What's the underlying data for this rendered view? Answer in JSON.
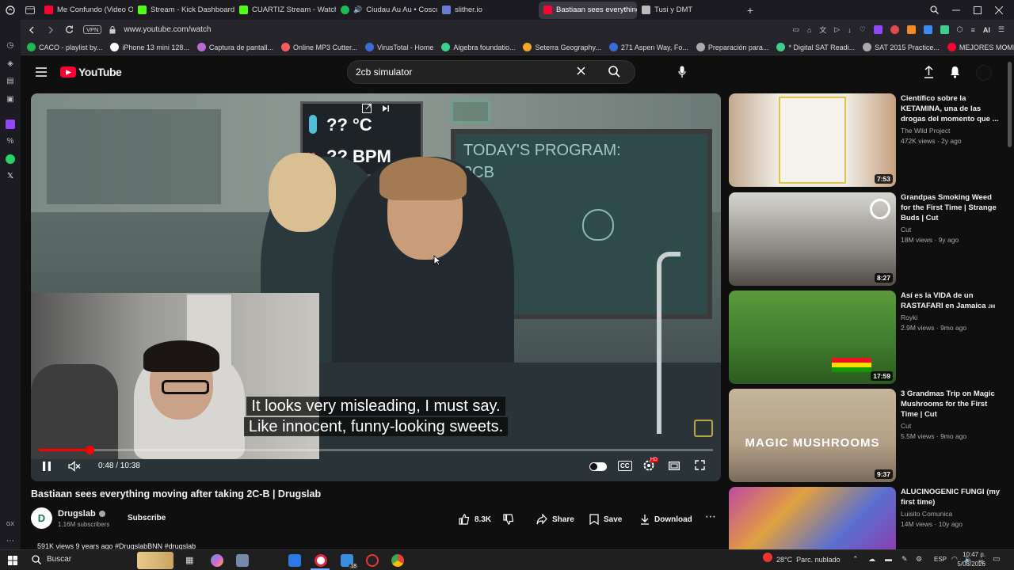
{
  "browser": {
    "tabs": [
      {
        "label": "Me Confundo (Video Officia",
        "color": "#ff0033"
      },
      {
        "label": "Stream - Kick Dashboard",
        "color": "#53fc18"
      },
      {
        "label": "CUARTIZ Stream - Watch L",
        "color": "#53fc18"
      },
      {
        "label": "Ciudau Au Au • Coscu",
        "color": "#1db954"
      },
      {
        "label": "slither.io",
        "color": "#6b7bd4"
      },
      {
        "label": "Bastiaan sees everything",
        "color": "#ff0033",
        "active": true
      },
      {
        "label": "Tusi y DMT",
        "color": "#bbbbbb"
      }
    ],
    "new_tab": "+",
    "vpn_label": "VPN",
    "url": "www.youtube.com/watch",
    "ai_label": "AI",
    "bookmarks": [
      {
        "label": "CACO - playlist by...",
        "color": "#1db954"
      },
      {
        "label": "iPhone 13 mini 128...",
        "color": "#ffffff"
      },
      {
        "label": "Captura de pantall...",
        "color": "#b86bd4"
      },
      {
        "label": "Online MP3 Cutter...",
        "color": "#ff5a5a"
      },
      {
        "label": "VirusTotal - Home",
        "color": "#3b6bd4"
      },
      {
        "label": "Algebra foundatio...",
        "color": "#3ecf8e"
      },
      {
        "label": "Seterra Geography...",
        "color": "#f5a623"
      },
      {
        "label": "271 Aspen Way, Fo...",
        "color": "#3b6bd4"
      },
      {
        "label": "Preparación para...",
        "color": "#aaaaaa"
      },
      {
        "label": "* Digital SAT Readi...",
        "color": "#3ecf8e"
      },
      {
        "label": "SAT 2015 Practice...",
        "color": "#aaaaaa"
      },
      {
        "label": "MEJORES MOMEN...",
        "color": "#ff0033"
      }
    ]
  },
  "youtube": {
    "logo": "YouTube",
    "search_value": "2cb simulator",
    "video": {
      "caption_line1": "It looks very misleading, I must say.",
      "caption_line2": "Like innocent, funny-looking sweets.",
      "board_text1": "TODAY'S PROGRAM:",
      "board_text2": "2CB",
      "screen_temp": "??  °C",
      "screen_bpm": "??  BPM",
      "time": "0:48 / 10:38",
      "progress": 0.075,
      "cc_label": "CC",
      "hd_badge": "HD"
    },
    "title": "Bastiaan sees everything moving after taking 2C-B | Drugslab",
    "channel": {
      "name": "Drugslab",
      "subscribers": "1.16M subscribers",
      "subscribe_label": "Subscribe"
    },
    "actions": {
      "likes": "8.3K",
      "share": "Share",
      "save": "Save",
      "download": "Download"
    },
    "meta": "591K views  9 years ago  #DrugslabBNN #drugslab",
    "recommendations": [
      {
        "title": "Científico sobre la KETAMINA, una de las drogas del momento que ...",
        "channel": "The Wild Project",
        "meta": "472K views · 2y ago",
        "duration": "7:53"
      },
      {
        "title": "Grandpas Smoking Weed for the First Time | Strange Buds | Cut",
        "channel": "Cut",
        "meta": "18M views · 9y ago",
        "duration": "8:27"
      },
      {
        "title": "Así es la VIDA de un RASTAFARI en Jamaica",
        "title_suffix": "JM",
        "channel": "Royki",
        "meta": "2.9M views · 9mo ago",
        "duration": "17:59"
      },
      {
        "title": "3 Grandmas Trip on Magic Mushrooms for the First Time | Cut",
        "channel": "Cut",
        "meta": "5.5M views · 9mo ago",
        "duration": "9:37",
        "overlay": "MAGIC MUSHROOMS"
      },
      {
        "title": "ALUCINOGENIC FUNGI (my first time)",
        "channel": "Luisito Comunica",
        "meta": "14M views · 10y ago",
        "duration": ""
      }
    ]
  },
  "taskbar": {
    "search_label": "Buscar",
    "weather": "28°C  Parc. nublado",
    "lang": "ESP",
    "time": "10:47 p. m.",
    "date": "5/08/2026",
    "badge": "18"
  }
}
